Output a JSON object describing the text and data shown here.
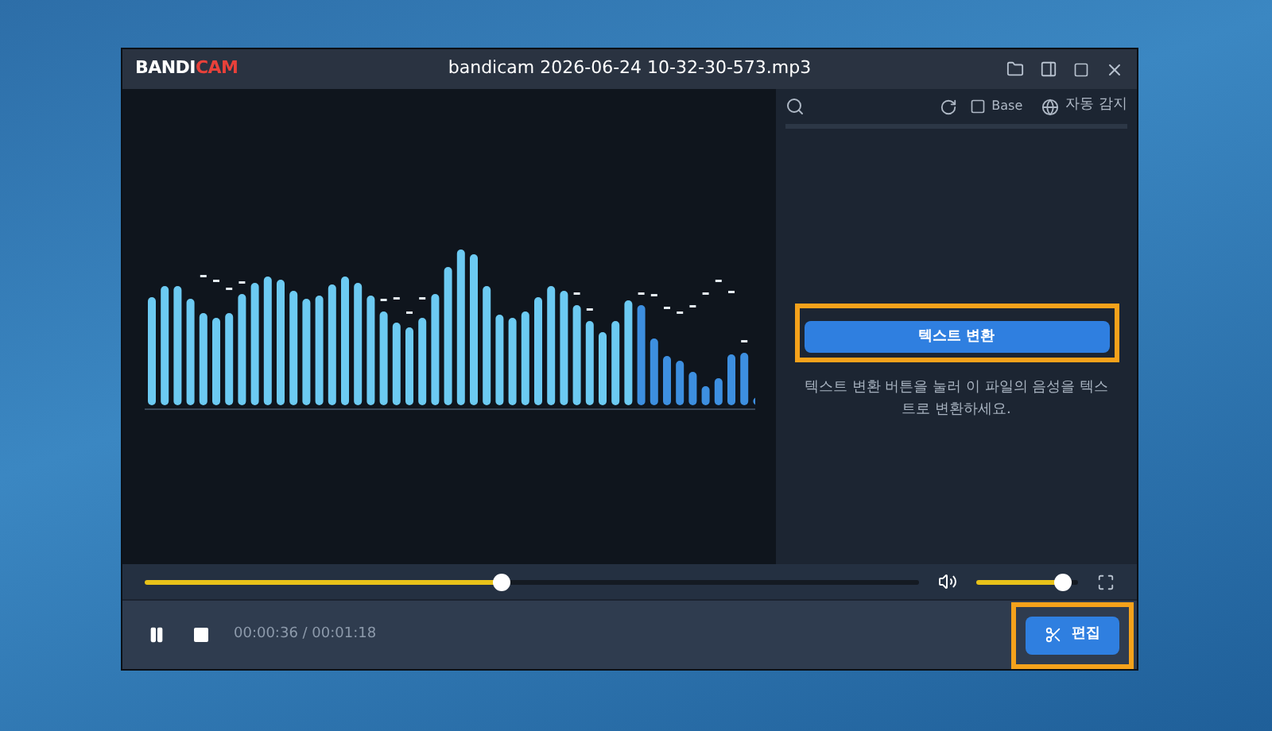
{
  "window": {
    "title": "bandicam 2026-06-24 10-32-30-573.mp3",
    "logo": {
      "part_1": "BANDI",
      "part_2": "CAM"
    }
  },
  "transcript_panel": {
    "model": "Base",
    "language": "자동 감지",
    "convert_button": "텍스트 변환",
    "hint": "텍스트 변환 버튼을 눌러 이 파일의 음성을 텍스트로 변환하세요."
  },
  "player": {
    "seek": {
      "level": 0.46
    },
    "volume": {
      "level": 0.92
    },
    "playing": true,
    "time": "00:00:36 / 00:01:18",
    "edit_button": "편집"
  }
}
